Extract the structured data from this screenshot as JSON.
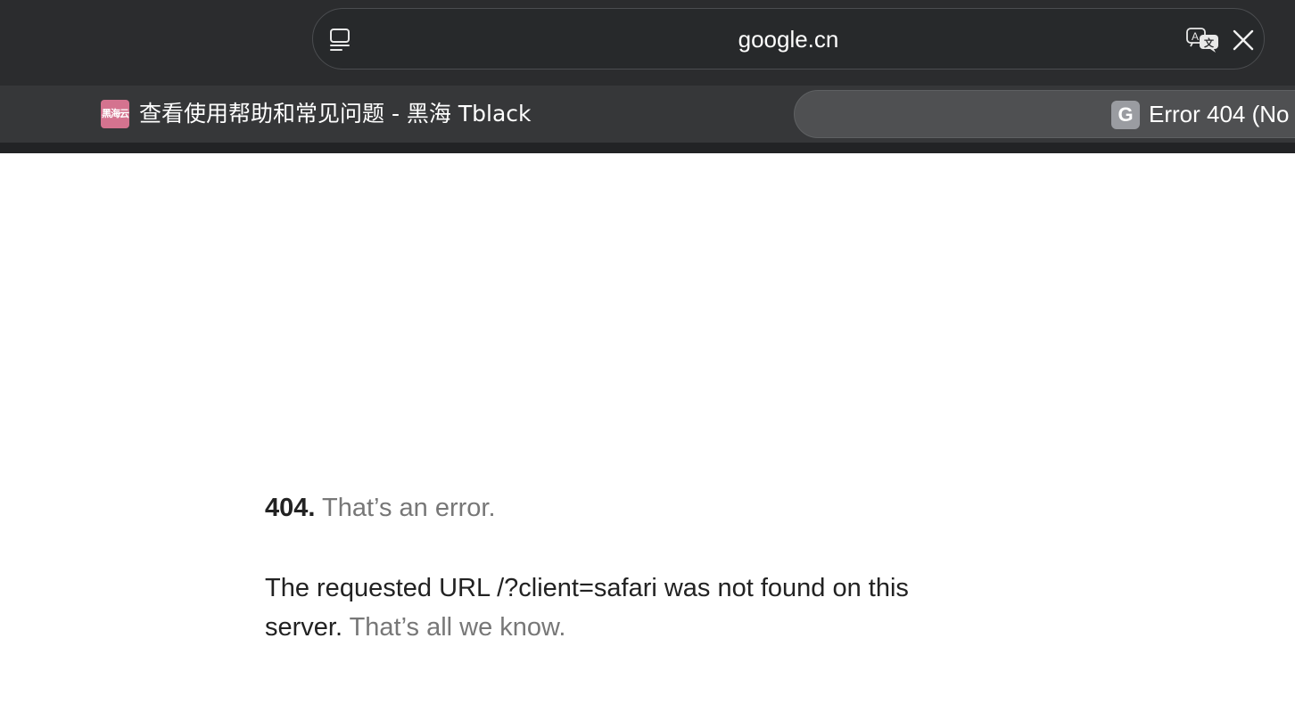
{
  "address_bar": {
    "url": "google.cn",
    "left_icon": "sidebar-icon",
    "right_icons": [
      "translate-icon",
      "close-icon"
    ]
  },
  "tabs": [
    {
      "favicon_text": "黑海云",
      "favicon_color": "#d4738f",
      "title": "查看使用帮助和常见问题 - 黑海 Tblack",
      "active": false
    },
    {
      "favicon_text": "G",
      "favicon_color": "#9a9ca1",
      "title": "Error 404 (No",
      "active": true
    }
  ],
  "page": {
    "error_code": "404.",
    "error_tagline": "That’s an error.",
    "message": "The requested URL /?client=safari was not found on this server.",
    "message_tail": "That’s all we know."
  }
}
